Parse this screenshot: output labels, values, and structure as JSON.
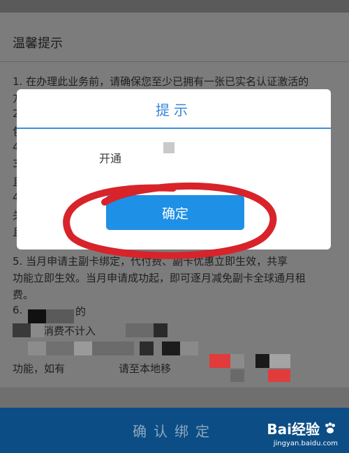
{
  "notice": {
    "title": "温馨提示",
    "lines": [
      "1. 在办理此业务前，请确保您至少已拥有一张已实名认证激活的",
      "5. 当月申请主副卡绑定，代付费、副卡优惠立即生效，共享",
      "功能立即生效。当月申请成功起，即可逐月减免副卡全球通月租",
      "费。",
      "6.",
      "消费不计入",
      "的",
      "功能，如有",
      "请至本地移"
    ],
    "partial_left_chars": [
      "方",
      "2",
      "包",
      "4",
      "3",
      "且",
      "4",
      "关",
      "且"
    ]
  },
  "modal": {
    "title": "提示",
    "message": "开通",
    "ok_label": "确定"
  },
  "bottom": {
    "confirm_label": "确认绑定"
  },
  "watermark": {
    "brand": "Bai经验",
    "url": "jingyan.baidu.com"
  },
  "colors": {
    "accent": "#1e90e6",
    "circle": "#d8232a",
    "bottom_bar": "#0c4d85"
  }
}
